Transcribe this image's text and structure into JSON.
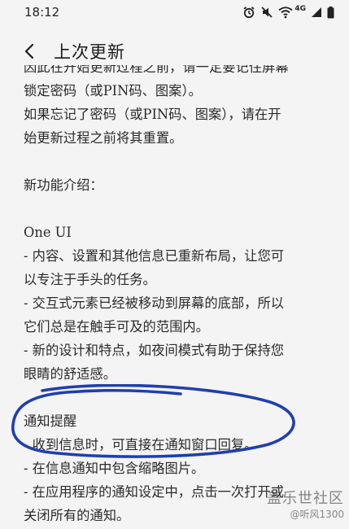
{
  "status_bar": {
    "time": "18:12",
    "network": "4G"
  },
  "header": {
    "title": "上次更新"
  },
  "content": {
    "paragraphs": [
      "因此在开始更新过程之前，请一定要记住屏幕",
      "锁定密码（或PIN码、图案）。",
      "如果忘记了密码（或PIN码、图案），请在开",
      "始更新过程之前将其重置。",
      "",
      "新功能介绍：",
      "",
      "One UI",
      "- 内容、设置和其他信息已重新布局，让您可",
      "以专注于手头的任务。",
      "- 交互式元素已经被移动到屏幕的底部，所以",
      "它们总是在触手可及的范围内。",
      "- 新的设计和特点，如夜间模式有助于保持您",
      "眼睛的舒适感。",
      "",
      "通知提醒",
      "- 收到信息时，可直接在通知窗口回复。",
      "- 在信息通知中包含缩略图片。",
      "- 在应用程序的通知设定中，点击一次打开或",
      "关闭所有的通知。"
    ]
  },
  "watermark": {
    "site": "盖乐世社区",
    "user": "@听风1300"
  },
  "colors": {
    "annotation_ink": "#1f3fb0",
    "background": "#f4f4f4"
  }
}
